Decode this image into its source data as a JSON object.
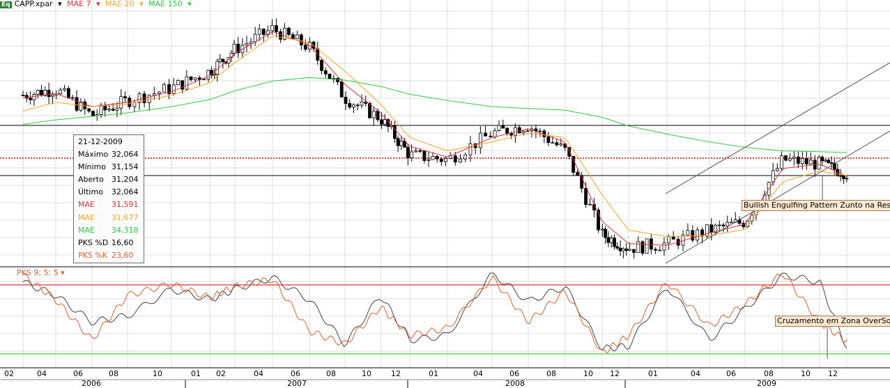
{
  "legend": {
    "symbol": "CAPP.xpar",
    "items": [
      {
        "label": "MAE 7",
        "color": "#e0303a"
      },
      {
        "label": "MAE 20",
        "color": "#f5a623"
      },
      {
        "label": "MAE 150",
        "color": "#2ecc40"
      }
    ]
  },
  "tooltip": {
    "date": "21-12-2009",
    "rows": [
      {
        "k": "Máximo",
        "v": "32,064",
        "color": "#000000"
      },
      {
        "k": "Mínimo",
        "v": "31,154",
        "color": "#000000"
      },
      {
        "k": "Aberto",
        "v": "31,204",
        "color": "#000000"
      },
      {
        "k": "Último",
        "v": "32,064",
        "color": "#000000"
      },
      {
        "k": "MAE",
        "v": "31,591",
        "color": "#e0303a"
      },
      {
        "k": "MAE",
        "v": "31,677",
        "color": "#f5a623"
      },
      {
        "k": "MAE",
        "v": "34,318",
        "color": "#2ecc40"
      },
      {
        "k": "PKS %D",
        "v": "16,60",
        "color": "#000000"
      },
      {
        "k": "PKS %K",
        "v": "23,60",
        "color": "#e06030"
      }
    ]
  },
  "annotations": {
    "pattern": "Bullish Engulfing Pattern Zunto na Resistê",
    "cross": "Cruzamento em Zona OverSold"
  },
  "oscillator_label": "PKS 9; 5; 5",
  "chart_data": [
    {
      "type": "candlestick",
      "title": "",
      "x": [
        "2006-02",
        "2006-04",
        "2006-06",
        "2006-08",
        "2006-10",
        "2007-01",
        "2007-02",
        "2007-04",
        "2007-06",
        "2007-08",
        "2007-10",
        "2007-12",
        "2008-01",
        "2008-04",
        "2008-06",
        "2008-08",
        "2008-10",
        "2008-12",
        "2009-01",
        "2009-04",
        "2009-06",
        "2009-08",
        "2009-10",
        "2009-12"
      ],
      "close_approx": [
        40.8,
        41.5,
        38.5,
        40.2,
        41.6,
        43.5,
        46.0,
        48.3,
        46.2,
        40.5,
        38.2,
        34.0,
        33.5,
        36.5,
        37.4,
        34.5,
        25.0,
        23.5,
        24.0,
        25.5,
        26.5,
        33.5,
        33.0,
        32.0
      ],
      "series": [
        {
          "name": "MAE 7",
          "values": [
            40.5,
            41.0,
            39.5,
            40.0,
            41.2,
            43.0,
            45.5,
            48.0,
            46.5,
            42.0,
            38.8,
            35.0,
            33.8,
            36.0,
            37.0,
            35.5,
            26.5,
            24.0,
            23.8,
            25.2,
            26.2,
            32.5,
            33.0,
            31.6
          ]
        },
        {
          "name": "MAE 20",
          "values": [
            39.0,
            40.0,
            39.5,
            39.8,
            40.8,
            42.2,
            44.5,
            47.5,
            46.8,
            43.5,
            39.8,
            36.0,
            34.5,
            35.5,
            36.5,
            36.0,
            29.5,
            25.5,
            24.8,
            24.9,
            25.6,
            31.0,
            32.2,
            31.7
          ]
        },
        {
          "name": "MAE 150",
          "values": [
            37.5,
            38.0,
            38.4,
            38.8,
            39.5,
            40.3,
            41.3,
            42.4,
            42.8,
            42.5,
            41.8,
            40.9,
            40.2,
            39.5,
            39.3,
            39.1,
            38.3,
            37.3,
            36.4,
            35.5,
            34.9,
            34.5,
            34.4,
            34.3
          ]
        }
      ],
      "horizontal_levels": [
        31.2,
        32.3,
        33.8
      ],
      "grid": true
    },
    {
      "type": "line",
      "title": "",
      "x": [
        "2006-02",
        "2006-04",
        "2006-06",
        "2006-08",
        "2006-10",
        "2007-01",
        "2007-02",
        "2007-04",
        "2007-06",
        "2007-08",
        "2007-10",
        "2007-12",
        "2008-01",
        "2008-04",
        "2008-06",
        "2008-08",
        "2008-10",
        "2008-12",
        "2009-01",
        "2009-04",
        "2009-06",
        "2009-08",
        "2009-10",
        "2009-12"
      ],
      "series": [
        {
          "name": "PKS %D",
          "values": [
            90,
            75,
            45,
            52,
            82,
            70,
            82,
            95,
            70,
            20,
            75,
            25,
            30,
            100,
            68,
            85,
            15,
            18,
            85,
            25,
            60,
            98,
            90,
            16.6
          ]
        },
        {
          "name": "PKS %K",
          "values": [
            98,
            70,
            25,
            75,
            88,
            72,
            85,
            93,
            35,
            20,
            62,
            30,
            38,
            95,
            45,
            80,
            10,
            30,
            90,
            40,
            65,
            100,
            45,
            23.6
          ]
        }
      ],
      "ylim": [
        0,
        100
      ],
      "levels": [
        80,
        20
      ]
    }
  ],
  "axis": {
    "months": [
      {
        "label": "02",
        "x": 13
      },
      {
        "label": "04",
        "x": 60
      },
      {
        "label": "06",
        "x": 112
      },
      {
        "label": "08",
        "x": 163
      },
      {
        "label": "10",
        "x": 226
      },
      {
        "label": "01",
        "x": 281
      },
      {
        "label": "02",
        "x": 317
      },
      {
        "label": "04",
        "x": 371
      },
      {
        "label": "06",
        "x": 424
      },
      {
        "label": "08",
        "x": 475
      },
      {
        "label": "10",
        "x": 526
      },
      {
        "label": "12",
        "x": 568
      },
      {
        "label": "01",
        "x": 622
      },
      {
        "label": "04",
        "x": 686
      },
      {
        "label": "06",
        "x": 738
      },
      {
        "label": "08",
        "x": 791
      },
      {
        "label": "10",
        "x": 844
      },
      {
        "label": "12",
        "x": 882
      },
      {
        "label": "01",
        "x": 937
      },
      {
        "label": "04",
        "x": 998
      },
      {
        "label": "06",
        "x": 1049
      },
      {
        "label": "08",
        "x": 1103
      },
      {
        "label": "10",
        "x": 1156
      },
      {
        "label": "12",
        "x": 1195
      }
    ],
    "years": [
      "2006",
      "2007",
      "2008",
      "2009"
    ]
  }
}
